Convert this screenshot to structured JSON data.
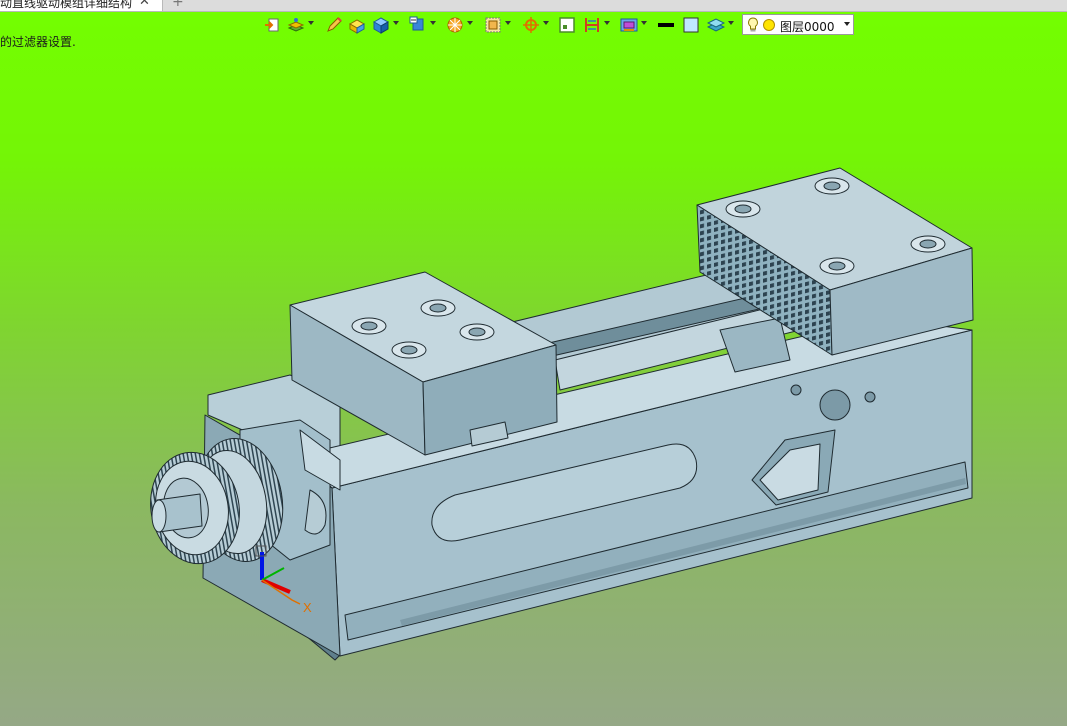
{
  "tabs": {
    "document_title": "动直线驱动模组详细结构",
    "close_glyph": "✕",
    "new_tab_glyph": "+"
  },
  "status": {
    "filter_message": "的过滤器设置."
  },
  "toolbar": {
    "layer": {
      "label": "图层0000"
    },
    "icons": [
      "import-icon",
      "layer-manager-icon",
      "pencil-icon",
      "cube-yellow-icon",
      "cube-blue-icon",
      "view-orient-icon",
      "wheel-filter-icon",
      "box-select-icon",
      "snap-target-icon",
      "frame-icon",
      "section-icon",
      "display-mode-icon",
      "line-color-icon",
      "fill-color-icon",
      "layer-stack-icon"
    ]
  },
  "triad": {
    "x_label": "X"
  },
  "colors": {
    "background_top": "#73ff00",
    "background_bottom": "#95a886",
    "model_face": "#a9c3cf",
    "model_dark": "#7fa0ad",
    "axis_x": "#e00000",
    "axis_y": "#00b400",
    "axis_z": "#0015e6"
  }
}
